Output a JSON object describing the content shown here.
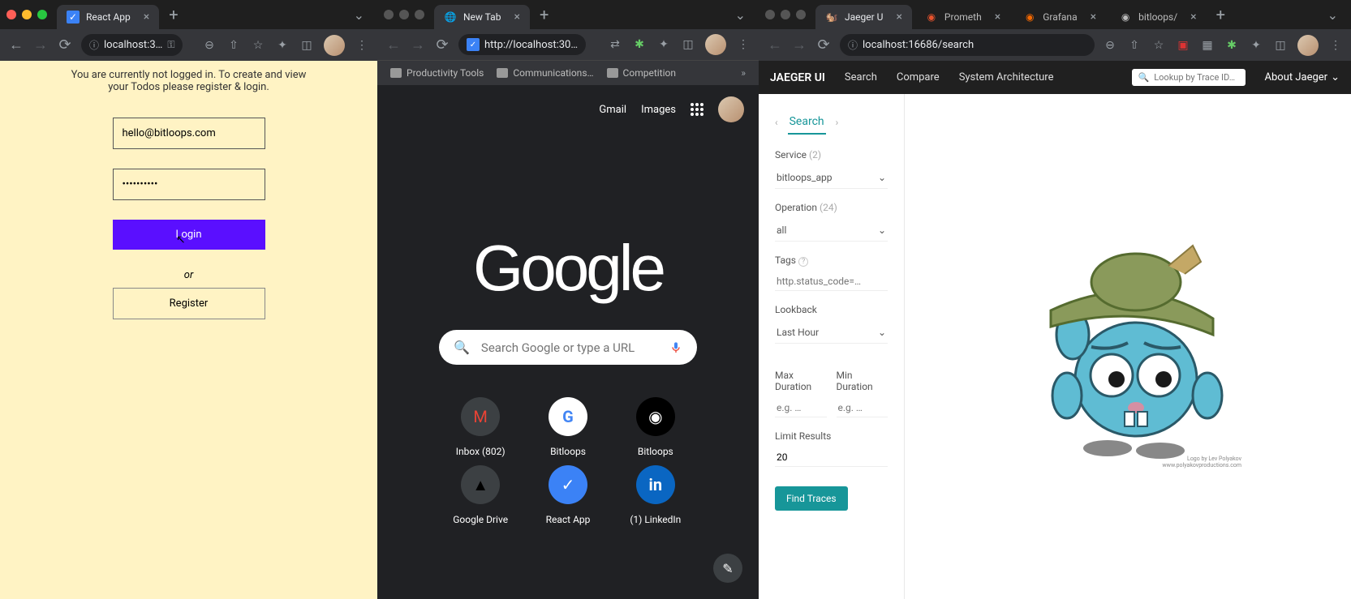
{
  "w1": {
    "tab_title": "React App",
    "url": "localhost:3…",
    "message": "You are currently not logged in. To create and view your Todos please register & login.",
    "email": "hello@bitloops.com",
    "password": "••••••••••",
    "login_label": "Login",
    "or_label": "or",
    "register_label": "Register"
  },
  "w2": {
    "tab_title": "New Tab",
    "url": "http://localhost:30…",
    "bookmarks": [
      "Productivity Tools",
      "Communications…",
      "Competition"
    ],
    "gmail": "Gmail",
    "images": "Images",
    "logo": "Google",
    "search_placeholder": "Search Google or type a URL",
    "shortcuts": [
      {
        "label": "Inbox (802)",
        "icon": "gmail"
      },
      {
        "label": "Bitloops",
        "icon": "g"
      },
      {
        "label": "Bitloops",
        "icon": "github"
      },
      {
        "label": "Google Drive",
        "icon": "drive"
      },
      {
        "label": "React App",
        "icon": "react"
      },
      {
        "label": "(1) LinkedIn",
        "icon": "in"
      }
    ]
  },
  "w3": {
    "tabs": [
      {
        "title": "Jaeger U",
        "active": true
      },
      {
        "title": "Prometh",
        "active": false
      },
      {
        "title": "Grafana",
        "active": false
      },
      {
        "title": "bitloops/",
        "active": false
      }
    ],
    "url": "localhost:16686/search",
    "brand": "JAEGER UI",
    "nav": [
      "Search",
      "Compare",
      "System Architecture"
    ],
    "trace_placeholder": "Lookup by Trace ID…",
    "about": "About Jaeger",
    "panel_tab": "Search",
    "service_label": "Service",
    "service_count": "(2)",
    "service_value": "bitloops_app",
    "operation_label": "Operation",
    "operation_count": "(24)",
    "operation_value": "all",
    "tags_label": "Tags",
    "tags_help": "?",
    "tags_placeholder": "http.status_code=…",
    "lookback_label": "Lookback",
    "lookback_value": "Last Hour",
    "max_label": "Max Duration",
    "min_label": "Min Duration",
    "duration_placeholder": "e.g. …",
    "limit_label": "Limit Results",
    "limit_value": "20",
    "find_label": "Find Traces",
    "credit": "Logo by Lev Polyakov\nwww.polyakovproductions.com"
  }
}
